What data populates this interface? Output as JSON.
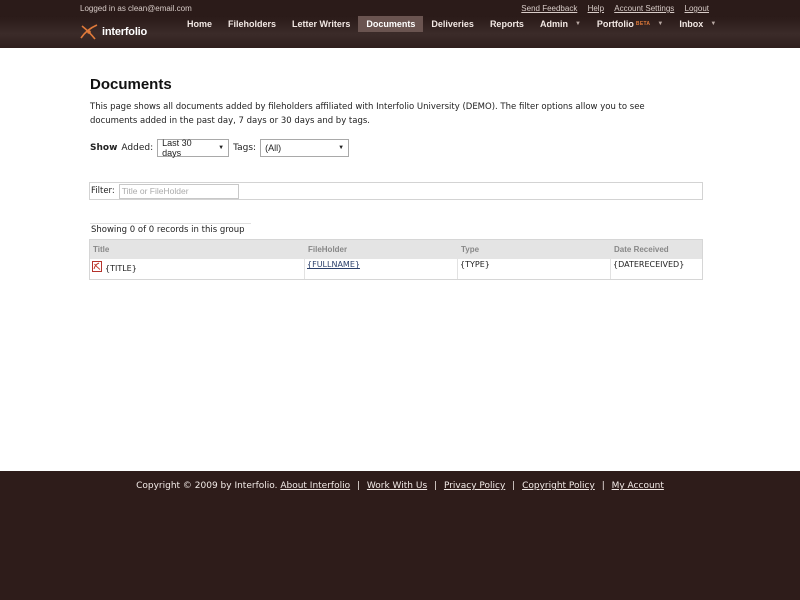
{
  "header": {
    "login_text": "Logged in as clean@email.com",
    "util_links": [
      "Send Feedback",
      "Help",
      "Account Settings",
      "Logout"
    ],
    "logo_text": "interfolio",
    "nav": [
      {
        "label": "Home"
      },
      {
        "label": "Fileholders"
      },
      {
        "label": "Letter Writers"
      },
      {
        "label": "Documents",
        "active": true
      },
      {
        "label": "Deliveries"
      },
      {
        "label": "Reports"
      },
      {
        "label": "Admin",
        "dropdown": true
      },
      {
        "label": "Portfolio",
        "badge": "BETA",
        "dropdown": true
      },
      {
        "label": "Inbox",
        "dropdown": true
      }
    ]
  },
  "main": {
    "title": "Documents",
    "intro": "This page shows all documents added by fileholders affiliated with Interfolio University (DEMO). The filter options allow you to see documents added in the past day, 7 days or 30 days and by tags.",
    "filters": {
      "show_label": "Show",
      "added_label": "Added:",
      "added_value": "Last 30 days",
      "tags_label": "Tags:",
      "tags_value": "(All)"
    },
    "filter_bar": {
      "label": "Filter:",
      "placeholder": "Title or FileHolder"
    },
    "showing_text": "Showing 0 of 0 records in this group",
    "table": {
      "headers": [
        "Title",
        "FileHolder",
        "Type",
        "Date Received"
      ],
      "rows": [
        {
          "title": "{TITLE}",
          "fileholder": "{FULLNAME}",
          "type": "{TYPE}",
          "date": "{DATERECEIVED}"
        }
      ]
    }
  },
  "footer": {
    "copyright": "Copyright © 2009 by Interfolio.",
    "links": [
      "About Interfolio",
      "Work With Us",
      "Privacy Policy",
      "Copyright Policy",
      "My Account"
    ]
  },
  "colors": {
    "header_bg": "#2e1e1c",
    "nav_active_bg": "#6a5450",
    "footer_bg": "#2e1c1a",
    "logo_accent": "#e07a3a"
  }
}
